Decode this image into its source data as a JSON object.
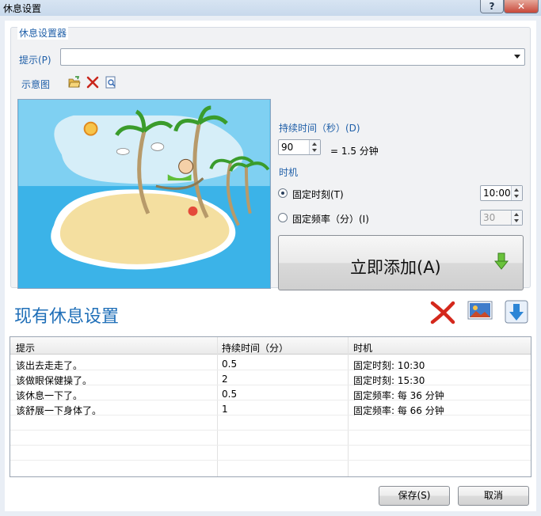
{
  "window": {
    "title": "休息设置",
    "help_label": "?",
    "close_label": "✕"
  },
  "form": {
    "group_title": "休息设置器",
    "prompt_label": "提示(P)",
    "prompt_value": "",
    "diagram_label": "示意图",
    "icons": [
      "open-folder-icon",
      "delete-icon",
      "preview-icon"
    ],
    "duration_label": "持续时间（秒）(D)",
    "duration_value": "90",
    "duration_minutes": "= 1.5 分钟",
    "time_label": "时机",
    "fixed_time_label": "固定时刻(T)",
    "fixed_time_value": "10:00",
    "fixed_time_checked": true,
    "fixed_freq_label": "固定频率（分）(I)",
    "fixed_freq_value": "30",
    "fixed_freq_checked": false,
    "add_now_label": "立即添加(A)"
  },
  "existing": {
    "title": "现有休息设置",
    "toolbar_icons": [
      "delete-x-icon",
      "image-icon",
      "download-icon"
    ]
  },
  "table": {
    "columns": [
      "提示",
      "持续时间（分）",
      "时机"
    ],
    "rows": [
      {
        "prompt": "该出去走走了。",
        "duration": "0.5",
        "timing": "固定时刻: 10:30"
      },
      {
        "prompt": "该做眼保健操了。",
        "duration": "2",
        "timing": "固定时刻: 15:30"
      },
      {
        "prompt": "该休息一下了。",
        "duration": "0.5",
        "timing": "固定频率: 每 36 分钟"
      },
      {
        "prompt": "该舒展一下身体了。",
        "duration": "1",
        "timing": "固定频率: 每 66 分钟"
      }
    ]
  },
  "footer": {
    "save_label": "保存(S)",
    "cancel_label": "取消"
  },
  "colors": {
    "accent_blue": "#1f5fa8",
    "section_title_blue": "#1f6fb8",
    "sky": "#3bb3e8",
    "sand": "#f4dfa0"
  }
}
